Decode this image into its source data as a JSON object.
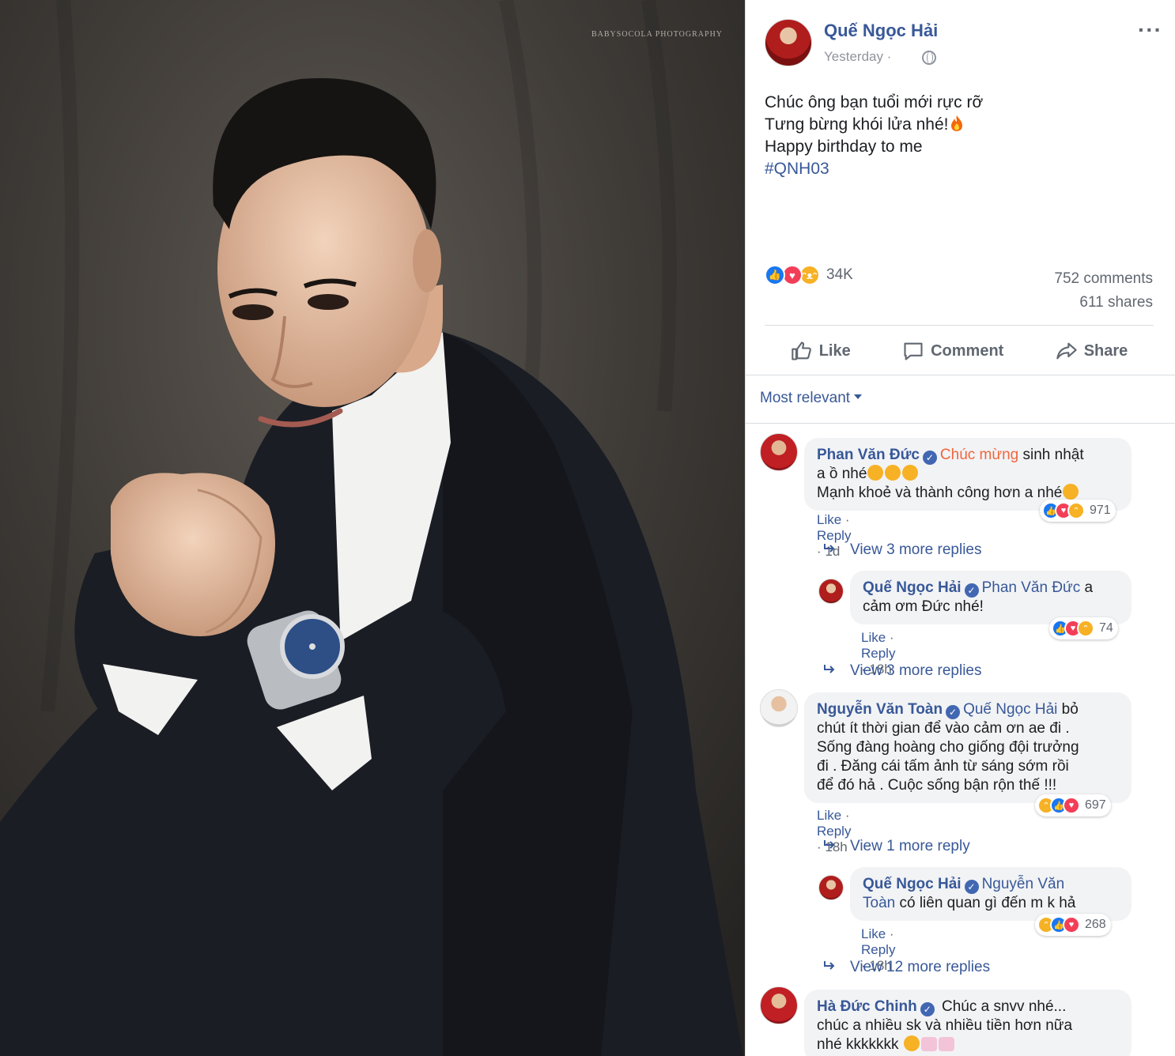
{
  "photo": {
    "watermark": "BABYSOCOLA PHOTOGRAPHY"
  },
  "post": {
    "author": "Quế Ngọc Hải",
    "time": "Yesterday ·",
    "lines": [
      "Chúc ông bạn tuổi mới rực rỡ",
      "Tưng bừng khói lửa nhé!",
      "Happy birthday to me"
    ],
    "hashtag": "#QNH03",
    "reactions_count": "34K",
    "comments_count": "752 comments",
    "shares_count": "611 shares"
  },
  "actions": {
    "like": "Like",
    "comment": "Comment",
    "share": "Share"
  },
  "sort": {
    "label": "Most relevant"
  },
  "comments": [
    {
      "author": "Phan Văn Đức",
      "mention": "Chúc mừng",
      "text_line1": " sinh nhật",
      "text_line2": "a ồ nhé",
      "text_line3": "Mạnh khoẻ và thành công hơn a nhé",
      "like": "Like",
      "reply": "Reply",
      "time": "1d",
      "reacts": "971"
    },
    {
      "view_more": "View 3 more replies"
    },
    {
      "author": "Quế Ngọc Hải",
      "mention": "Phan Văn Đức",
      "text_after": " a",
      "text_line2": "cảm ơm Đức nhé!",
      "like": "Like",
      "reply": "Reply",
      "time": "18h",
      "reacts": "74"
    },
    {
      "view_more": "View 3 more replies"
    },
    {
      "author": "Nguyễn Văn Toàn",
      "mention": "Quế Ngọc Hải",
      "text_after": " bỏ",
      "text_line2": "chút ít thời gian để vào cảm ơn ae đi .",
      "text_line3": "Sống đàng hoàng cho giống đội trưởng",
      "text_line4": "đi . Đăng cái tấm ảnh từ sáng sớm rồi",
      "text_line5": "để đó hả . Cuộc sống bận rộn thế !!!",
      "like": "Like",
      "reply": "Reply",
      "time": "18h",
      "reacts": "697"
    },
    {
      "view_more": "View 1 more reply"
    },
    {
      "author": "Quế Ngọc Hải",
      "mention_part1": "Nguyễn Văn",
      "mention_part2": "Toàn",
      "text_line2": " có liên quan gì đến m k hả",
      "like": "Like",
      "reply": "Reply",
      "time": "18h",
      "reacts": "268"
    },
    {
      "view_more": "View 12 more replies"
    },
    {
      "author": "Hà Đức Chinh",
      "text_after": " Chúc a snvv nhé...",
      "text_line2": "chúc a nhiều sk và nhiều tiền hơn nữa",
      "text_line3": "nhé kkkkkkk"
    }
  ],
  "colors": {
    "link_blue": "#385898",
    "meta_grey": "#606770",
    "like_blue": "#1877f2",
    "love_red": "#f33e58",
    "haha_yellow": "#f7b125",
    "mention_orange": "#f0663d"
  },
  "icons": [
    "more-icon",
    "globe-icon",
    "fire-icon",
    "like-icon",
    "comment-icon",
    "share-icon",
    "caret-icon",
    "verified-icon",
    "reply-arrow-icon"
  ]
}
